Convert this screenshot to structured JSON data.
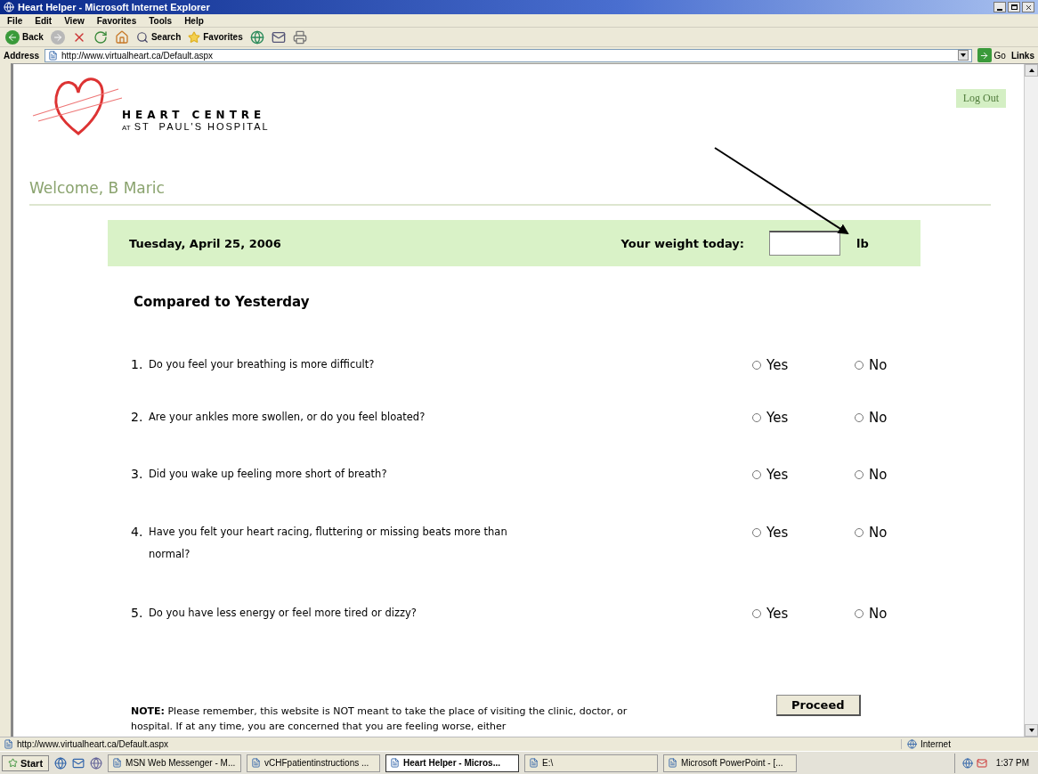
{
  "window": {
    "title": "Heart Helper - Microsoft Internet Explorer"
  },
  "menu": [
    "File",
    "Edit",
    "View",
    "Favorites",
    "Tools",
    "Help"
  ],
  "toolbar": {
    "back": "Back",
    "search": "Search",
    "favorites": "Favorites"
  },
  "address": {
    "label": "Address",
    "value": "http://www.virtualheart.ca/Default.aspx",
    "go": "Go",
    "links": "Links"
  },
  "page": {
    "logo": {
      "title": "HEART CENTRE",
      "prefix": "AT",
      "subtitle": "ST  PAUL'S HOSPITAL"
    },
    "logout": "Log Out",
    "welcome": "Welcome, B Maric",
    "date": "Tuesday, April 25, 2006",
    "weight_label": "Your weight today:",
    "weight_unit": "lb",
    "section": "Compared to Yesterday",
    "questions": [
      {
        "number": "1.",
        "text": "Do you feel your breathing is more difficult?",
        "options": [
          {
            "label": "Yes",
            "selected": false
          },
          {
            "label": "No",
            "selected": false
          }
        ]
      },
      {
        "number": "2.",
        "text": "Are your ankles more swollen, or do you feel bloated?",
        "options": [
          {
            "label": "Yes",
            "selected": false
          },
          {
            "label": "No",
            "selected": false
          }
        ]
      },
      {
        "number": "3.",
        "text": "Did you wake up feeling more short of breath?",
        "options": [
          {
            "label": "Yes",
            "selected": false
          },
          {
            "label": "No",
            "selected": false
          }
        ]
      },
      {
        "number": "4.",
        "text": "Have you felt your heart racing, fluttering or missing beats more than normal?",
        "options": [
          {
            "label": "Yes",
            "selected": false
          },
          {
            "label": "No",
            "selected": false
          }
        ]
      },
      {
        "number": "5.",
        "text": "Do you have less energy or feel more tired or dizzy?",
        "options": [
          {
            "label": "Yes",
            "selected": false
          },
          {
            "label": "No",
            "selected": false
          }
        ]
      }
    ],
    "note": "**NOTE:** Please remember, this website is NOT meant to take the place of visiting the clinic, doctor, or hospital. If at any time, you are concerned that you are feeling worse, either",
    "proceed": "Proceed"
  },
  "status_bar": {
    "url": "http://www.virtualheart.ca/Default.aspx",
    "zone": "Internet"
  },
  "taskbar": {
    "start": "Start",
    "tasks": [
      {
        "label": "MSN Web Messenger - M...",
        "selected": false
      },
      {
        "label": "vCHFpatientinstructions ...",
        "selected": false
      },
      {
        "label": "Heart Helper - Micros...",
        "selected": true
      },
      {
        "label": "E:\\",
        "selected": false
      },
      {
        "label": "Microsoft PowerPoint - [...",
        "selected": false
      }
    ],
    "clock": "1:37 PM"
  }
}
